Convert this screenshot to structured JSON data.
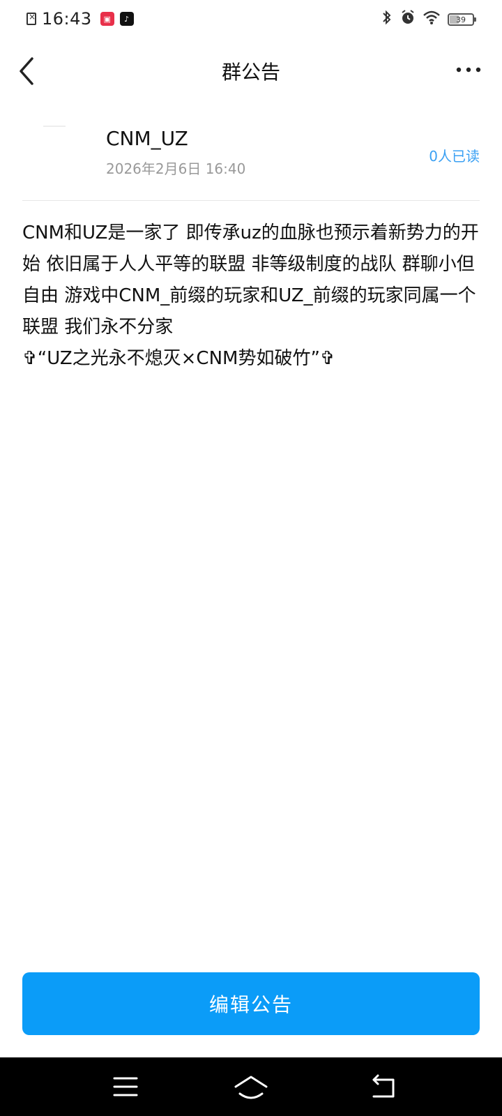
{
  "status_bar": {
    "time": "16:43",
    "app_icons": [
      "red-app-icon",
      "tiktok-icon"
    ],
    "right_icons": [
      "bluetooth-icon",
      "alarm-icon",
      "wifi-icon"
    ],
    "battery_level": "39"
  },
  "header": {
    "title": "群公告"
  },
  "announcement": {
    "author": "CNM_UZ",
    "date": "2026年2月6日 16:40",
    "read_count": "0人已读",
    "body": "CNM和UZ是一家了 即传承uz的血脉也预示着新势力的开始 依旧属于人人平等的联盟 非等级制度的战队 群聊小但自由 游戏中CNM_前缀的玩家和UZ_前缀的玩家同属一个联盟 我们永不分家\n✞“UZ之光永不熄灭×CNM势如破竹”✞"
  },
  "actions": {
    "edit_label": "编辑公告"
  },
  "colors": {
    "accent": "#0b9cf8",
    "link": "#3aa0f3"
  }
}
